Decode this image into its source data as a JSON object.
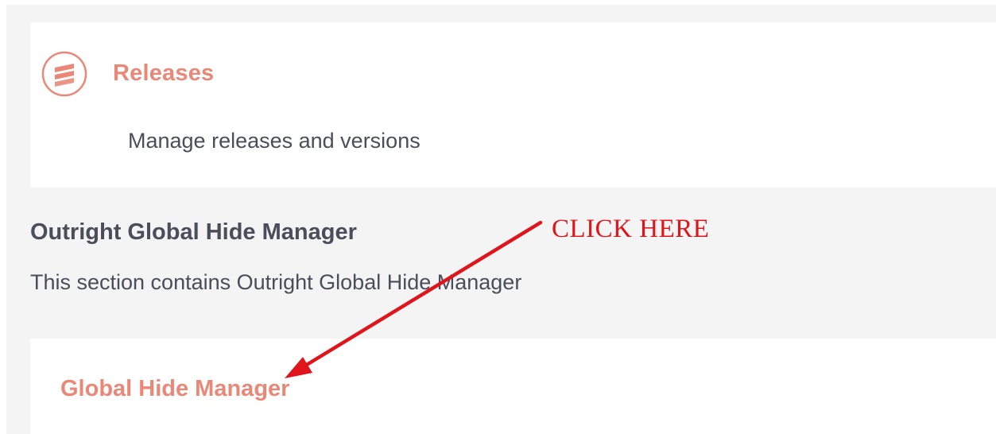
{
  "releases": {
    "title": "Releases",
    "description": "Manage releases and versions",
    "icon": "layers-icon"
  },
  "section": {
    "title": "Outright Global Hide Manager",
    "description": "This section contains Outright Global Hide Manager"
  },
  "global_hide": {
    "link_label": "Global Hide Manager"
  },
  "annotation": {
    "text": "CLICK HERE",
    "color": "#e0141b"
  },
  "colors": {
    "accent": "#ea8878",
    "text": "#4a4d5a",
    "background": "#f4f4f4"
  }
}
